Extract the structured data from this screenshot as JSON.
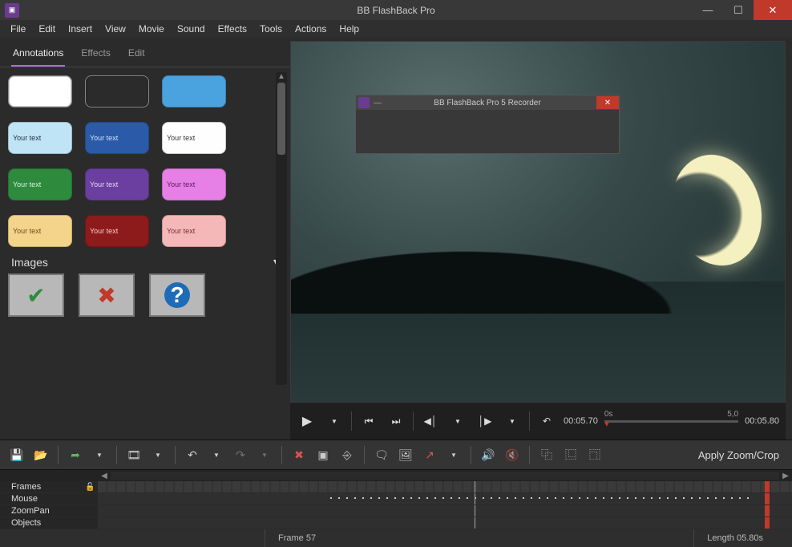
{
  "title": "BB FlashBack Pro",
  "menu": [
    "File",
    "Edit",
    "Insert",
    "View",
    "Movie",
    "Sound",
    "Effects",
    "Tools",
    "Actions",
    "Help"
  ],
  "side_tabs": [
    "Annotations",
    "Effects",
    "Edit"
  ],
  "active_side_tab": 0,
  "bubbles": [
    {
      "text": "",
      "bg": "#ffffff",
      "color": "#333",
      "outline": true
    },
    {
      "text": "",
      "bg": "#2b2b2b",
      "color": "#fff",
      "outline": true
    },
    {
      "text": "",
      "bg": "#4aa3df",
      "color": "#fff"
    },
    {
      "text": "Your text",
      "bg": "#bfe4f5",
      "color": "#234"
    },
    {
      "text": "Your text",
      "bg": "#2b5aa8",
      "color": "#cfe0ff"
    },
    {
      "text": "Your text",
      "bg": "#fefefe",
      "color": "#333"
    },
    {
      "text": "Your text",
      "bg": "#2e8b3e",
      "color": "#d9f2dc"
    },
    {
      "text": "Your text",
      "bg": "#6b3fa0",
      "color": "#e4d4f5"
    },
    {
      "text": "Your text",
      "bg": "#e67fe6",
      "color": "#5a1d5a"
    },
    {
      "text": "Your text",
      "bg": "#f4d48a",
      "color": "#6b4a1d"
    },
    {
      "text": "Your text",
      "bg": "#8e1b1b",
      "color": "#f5cccc"
    },
    {
      "text": "Your text",
      "bg": "#f5b8b8",
      "color": "#7a2a2a"
    }
  ],
  "images_section": "Images",
  "image_icons": [
    "check",
    "cross",
    "question"
  ],
  "recorder_title": "BB FlashBack Pro 5 Recorder",
  "playback": {
    "current_time": "00:05.70",
    "slider_start": "0s",
    "slider_end": "5,0",
    "total_time": "00:05.80"
  },
  "toolbar_text": "Apply Zoom/Crop",
  "tracks": [
    "Frames",
    "Mouse",
    "ZoomPan",
    "Objects"
  ],
  "status": {
    "frame": "Frame 57",
    "length": "Length 05.80s"
  }
}
